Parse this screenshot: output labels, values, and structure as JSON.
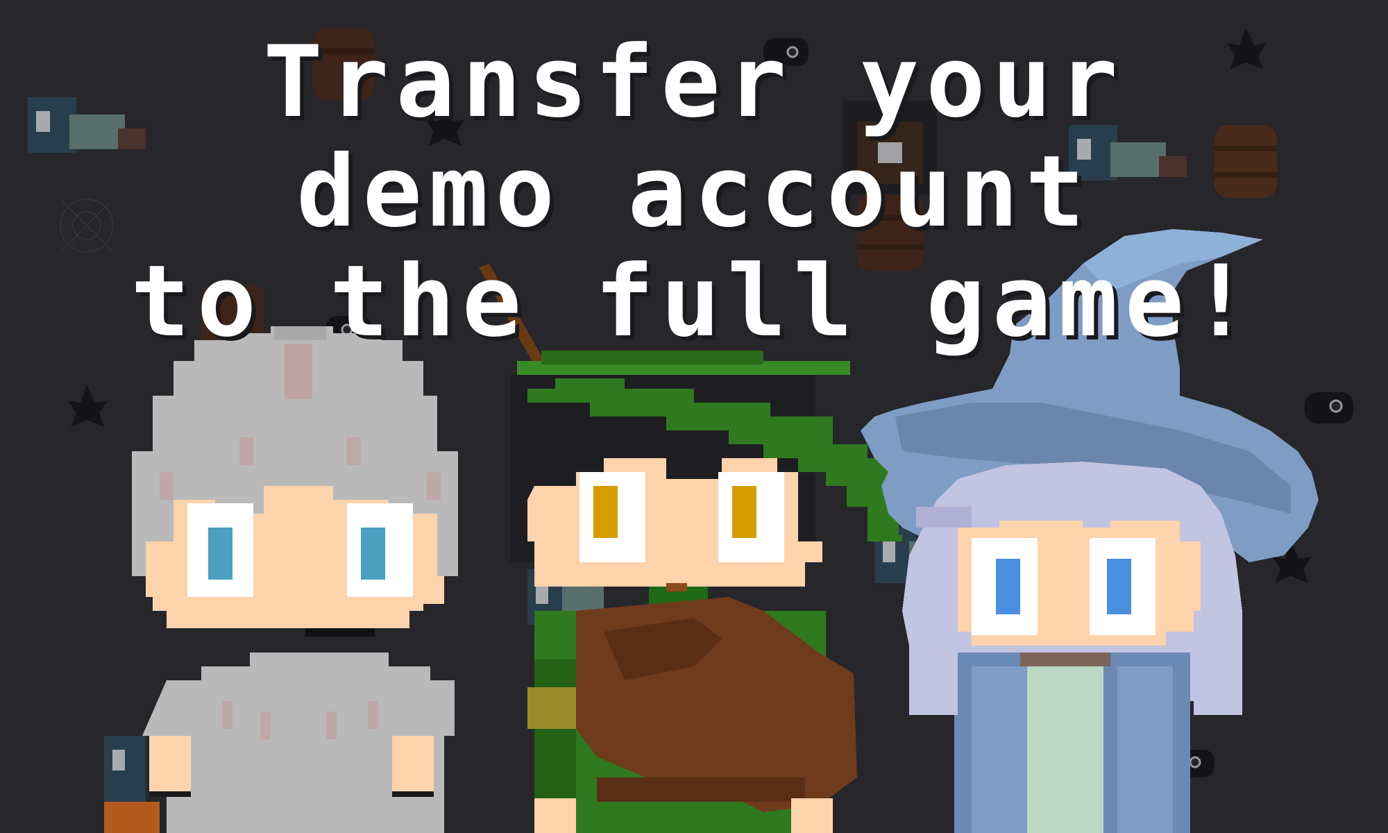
{
  "headline": {
    "line1": "Transfer your",
    "line2": "demo account",
    "line3": "to the full game!"
  },
  "colors": {
    "background": "#26262b",
    "headline_text": "#ffffff",
    "knight_armor": "#b7b7b7",
    "knight_eyes": "#4a9cc0",
    "ranger_hat": "#2f7a1f",
    "ranger_eyes": "#d69d00",
    "ranger_tunic": "#6e3b1c",
    "wizard_hat": "#7e9cc4",
    "wizard_hair": "#c3c3e2",
    "wizard_eyes": "#4a8fe0",
    "skin": "#fdd3ac"
  },
  "characters": [
    {
      "role": "knight",
      "icon": "knight-character-icon"
    },
    {
      "role": "ranger",
      "icon": "ranger-character-icon"
    },
    {
      "role": "wizard",
      "icon": "wizard-character-icon"
    }
  ],
  "background_sprites": [
    "zombie-sprite-icon",
    "barrel-icon",
    "star-sprite-icon",
    "bat-sprite-icon",
    "lantern-icon",
    "cobweb-icon"
  ]
}
